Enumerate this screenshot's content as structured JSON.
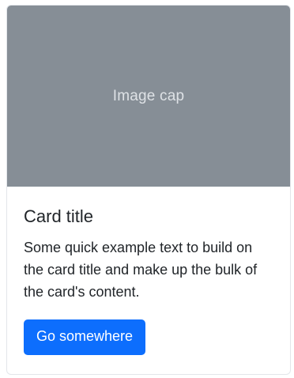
{
  "card": {
    "image_cap_text": "Image cap",
    "title": "Card title",
    "text": "Some quick example text to build on the card title and make up the bulk of the card's content.",
    "button_label": "Go somewhere"
  },
  "colors": {
    "image_placeholder": "#868e96",
    "primary_button": "#0d6efd"
  }
}
